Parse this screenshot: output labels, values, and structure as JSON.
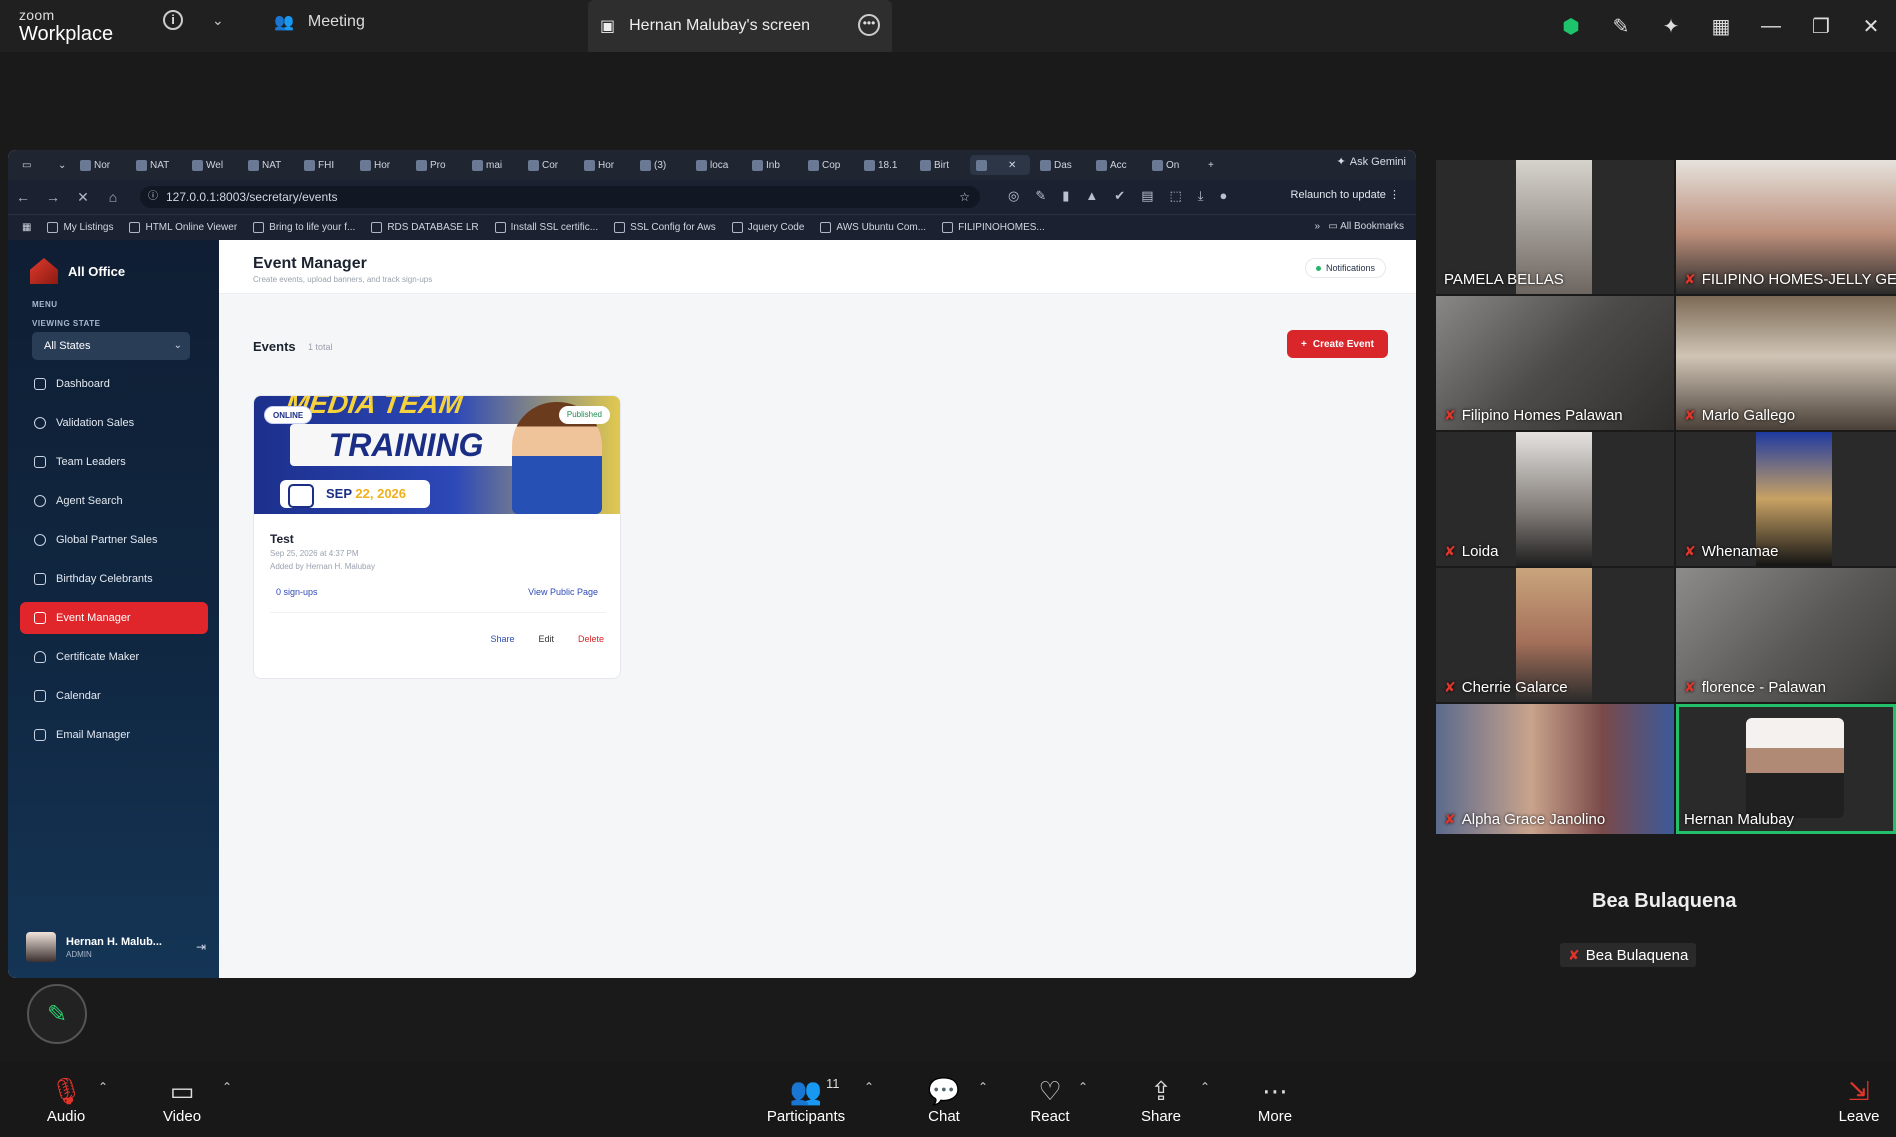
{
  "zoom": {
    "brand_top": "zoom",
    "brand_bottom": "Workplace",
    "meeting_label": "Meeting",
    "screen_tab": "Hernan Malubay's screen"
  },
  "browser": {
    "tabs": [
      "Nor",
      "NAT",
      "Wel",
      "NAT",
      "FHI",
      "Hor",
      "Pro",
      "mai",
      "Cor",
      "Hor",
      "(3)",
      "loca",
      "Inb",
      "Cop",
      "18.1",
      "Birt",
      "",
      "Das",
      "Acc",
      "On"
    ],
    "ask_gemini": "Ask Gemini",
    "url": "127.0.0.1:8003/secretary/events",
    "relaunch": "Relaunch to update",
    "bookmarks": [
      "My Listings",
      "HTML Online Viewer",
      "Bring to life your f...",
      "RDS DATABASE LR",
      "Install SSL certific...",
      "SSL Config for Aws",
      "Jquery Code",
      "AWS Ubuntu Com...",
      "FILIPINOHOMES..."
    ],
    "all_bookmarks": "All Bookmarks"
  },
  "app": {
    "brand": "All Office",
    "menu_header": "MENU",
    "viewing_state_header": "VIEWING STATE",
    "state_select": "All States",
    "nav": [
      "Dashboard",
      "Validation Sales",
      "Team Leaders",
      "Agent Search",
      "Global Partner Sales",
      "Birthday Celebrants",
      "Event Manager",
      "Certificate Maker",
      "Calendar",
      "Email Manager"
    ],
    "active_nav": "Event Manager",
    "user_name": "Hernan H. Malub...",
    "user_role": "ADMIN"
  },
  "page": {
    "title": "Event Manager",
    "subtitle": "Create events, upload banners, and track sign-ups",
    "notifications": "Notifications",
    "events_header": "Events",
    "events_count": "1 total",
    "create_button": "Create Event"
  },
  "event": {
    "banner_top": "MEDIA TEAM",
    "banner_main": "TRAINING",
    "banner_date_month": "SEP",
    "banner_date_rest": "22, 2026",
    "badge_online": "ONLINE",
    "badge_status": "Published",
    "title": "Test",
    "datetime": "Sep 25, 2026 at 4:37 PM",
    "added_by": "Added by Hernan H. Malubay",
    "signups": "0 sign-ups",
    "view_public": "View Public Page",
    "share": "Share",
    "edit": "Edit",
    "delete": "Delete"
  },
  "participants": [
    "PAMELA BELLAS",
    "FILIPINO HOMES-JELLY GES",
    "Filipino Homes Palawan",
    "Marlo Gallego",
    "Loida",
    "Whenamae",
    "Cherrie Galarce",
    "florence - Palawan",
    "Alpha Grace Janolino",
    "Hernan Malubay"
  ],
  "bea_big": "Bea Bulaquena",
  "bea_small": "Bea Bulaquena",
  "toolbar": {
    "audio": "Audio",
    "video": "Video",
    "participants": "Participants",
    "participant_count": "11",
    "chat": "Chat",
    "react": "React",
    "share": "Share",
    "more": "More",
    "leave": "Leave"
  }
}
